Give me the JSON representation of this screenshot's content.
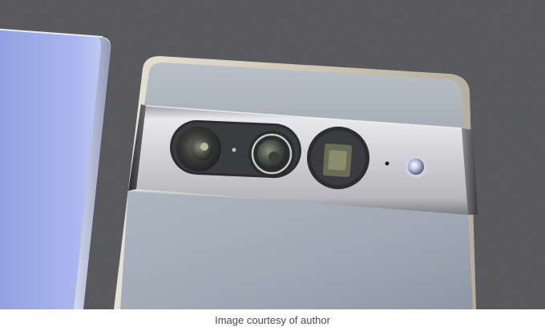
{
  "figure": {
    "alt": "Close-up photograph of the back of a smartphone with a polished metal camera bar, next to another phone on a grey felt surface",
    "caption": "Image courtesy of author"
  },
  "colors": {
    "felt": "#4d4e52",
    "phone_body": "#a9b2bd",
    "camera_bar": "#c9c9cc",
    "left_phone": "#a9b6ea",
    "caption_text": "#4a4a4a"
  }
}
